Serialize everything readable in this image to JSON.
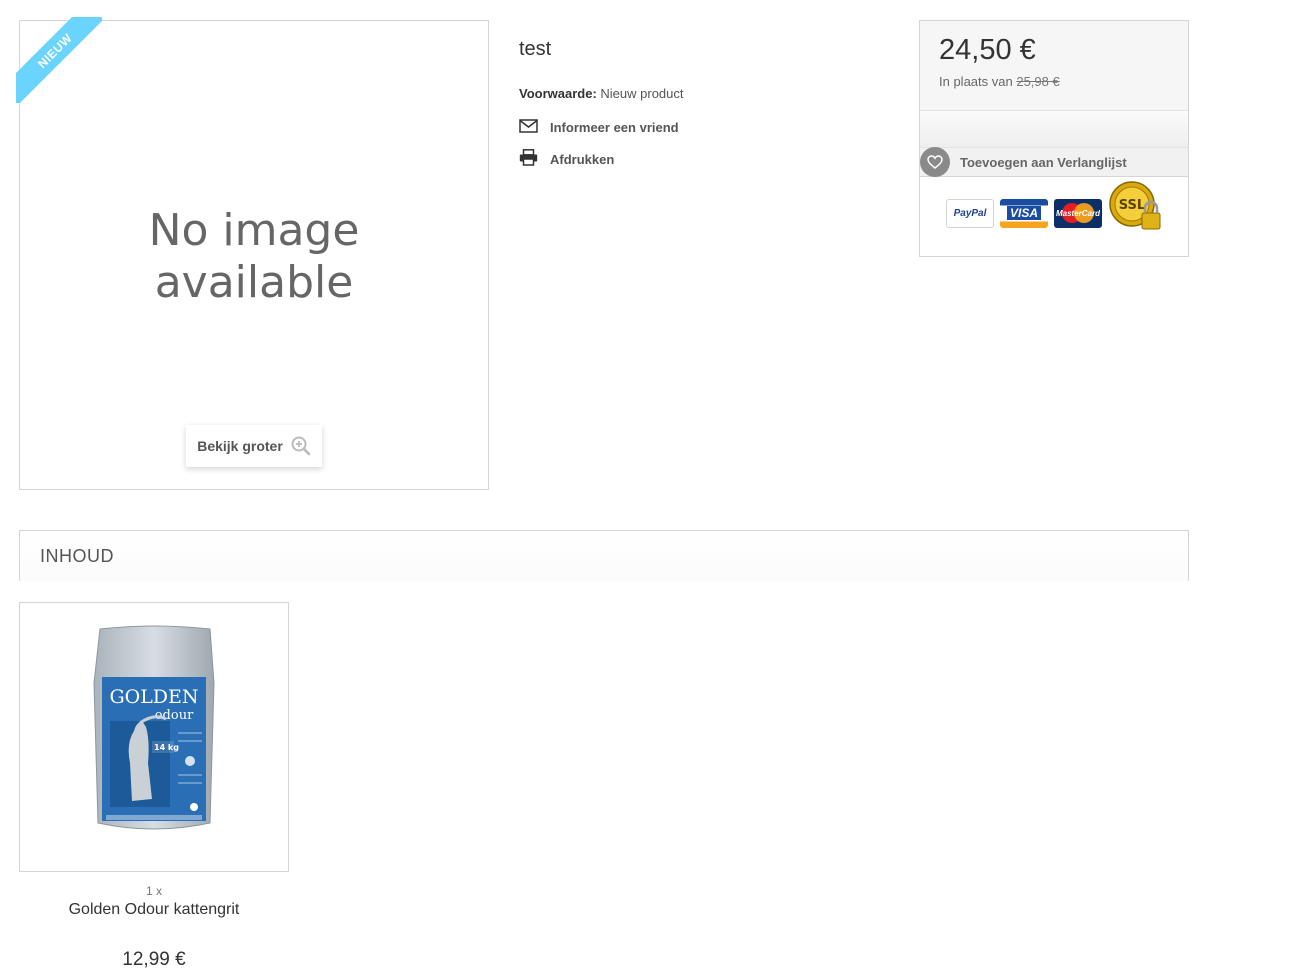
{
  "product": {
    "badge_new": "NIEUW",
    "no_image_line1": "No image",
    "no_image_line2": "available",
    "view_larger_label": "Bekijk groter",
    "name": "test",
    "condition_label": "Voorwaarde:",
    "condition_value": "Nieuw product",
    "send_to_friend_label": "Informeer een vriend",
    "print_label": "Afdrukken"
  },
  "buy_box": {
    "price": "24,50 €",
    "old_price_prefix": "In plaats van",
    "old_price": "25,98 €",
    "wishlist_label": "Toevoegen aan Verlanglijst",
    "payment_logos": [
      "PayPal",
      "VISA",
      "MasterCard",
      "SSL"
    ]
  },
  "section": {
    "title": "INHOUD"
  },
  "pack_items": [
    {
      "quantity": "1 x",
      "name": "Golden Odour kattengrit",
      "price": "12,99 €",
      "image_brand": "GOLDEN",
      "image_sub": "odour",
      "image_weight": "14 kg"
    }
  ],
  "colors": {
    "ribbon": "#6ad4ff",
    "border": "#d6d4d4",
    "bag_blue": "#2a6fb5"
  }
}
